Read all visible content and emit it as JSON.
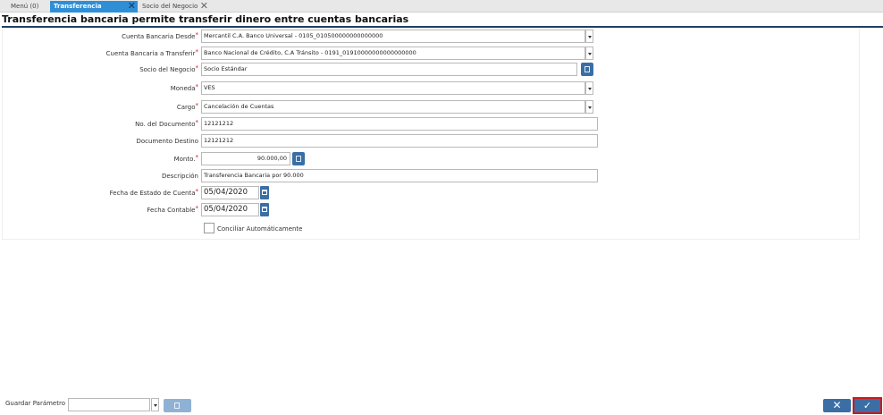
{
  "tabs": [
    {
      "label": "Menú (0)"
    },
    {
      "label": "Transferencia Bancaria",
      "close": "✕"
    },
    {
      "label": "Socio del Negocio",
      "close": "✕"
    }
  ],
  "title": "Transferencia bancaria permite transferir dinero entre cuentas bancarias",
  "required_mark": "*",
  "form": {
    "cuenta_desde": {
      "label": "Cuenta Bancaria Desde",
      "value": "Mercantil C.A. Banco Universal - 0105_010500000000000000"
    },
    "cuenta_transferir": {
      "label": "Cuenta Bancaria a Transferir",
      "value": "Banco Nacional de Crédito, C.A Tránsito - 0191_01910000000000000000"
    },
    "socio": {
      "label": "Socio del Negocio",
      "value": "Socio Estándar"
    },
    "moneda": {
      "label": "Moneda",
      "value": "VES"
    },
    "cargo": {
      "label": "Cargo",
      "value": "Cancelación de Cuentas"
    },
    "no_documento": {
      "label": "No. del Documento",
      "value": "12121212"
    },
    "documento_destino": {
      "label": "Documento Destino",
      "value": "12121212"
    },
    "monto": {
      "label": "Monto.",
      "value": "90.000,00"
    },
    "descripcion": {
      "label": "Descripción",
      "value": "Transferencia Bancaria por 90.000"
    },
    "fecha_estado": {
      "label": "Fecha de Estado de Cuenta",
      "value": "05/04/2020"
    },
    "fecha_contable": {
      "label": "Fecha Contable",
      "value": "05/04/2020"
    },
    "conciliar": {
      "label": "Conciliar Automáticamente",
      "checked": false
    }
  },
  "footer": {
    "guardar_label": "Guardar Parámetro",
    "guardar_value": "",
    "cancel_glyph": "✕",
    "ok_glyph": "✓"
  },
  "icons": {
    "tab_close": "close-icon",
    "dropdown": "chevron-down-icon",
    "search": "search-icon",
    "calculator": "calculator-icon",
    "calendar": "calendar-icon",
    "delete": "trash-icon"
  },
  "colors": {
    "active_tab": "#2f8fd6",
    "button_blue": "#3a6ea5",
    "required": "#d01818",
    "title_rule": "#1d3f66"
  }
}
